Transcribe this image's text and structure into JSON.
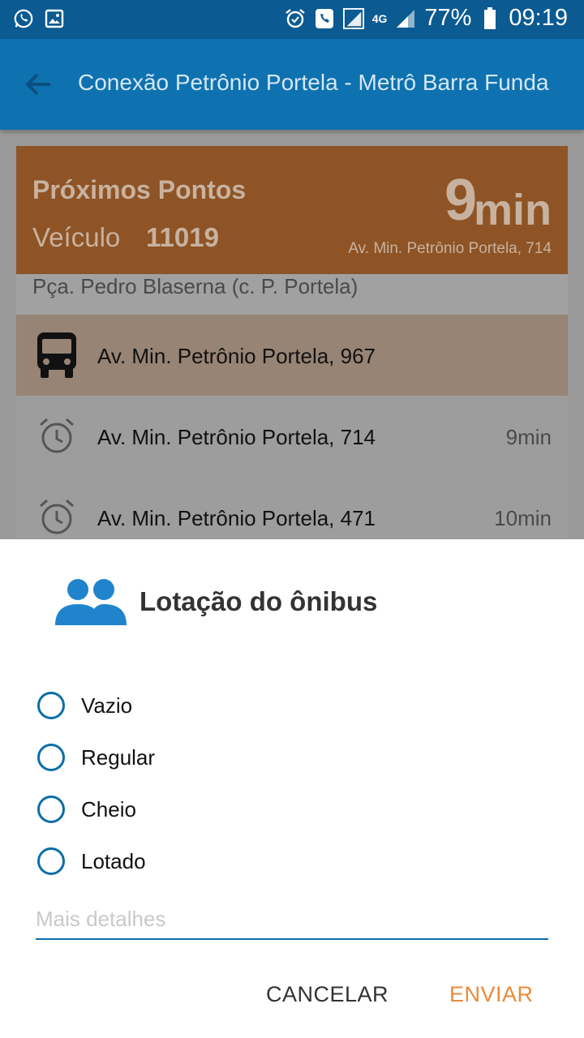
{
  "status_bar": {
    "battery_percent": "77%",
    "time": "09:19",
    "network_label": "4G",
    "icons": [
      "whatsapp-icon",
      "gallery-icon",
      "alarm-icon",
      "phone-icon",
      "signal-icon",
      "battery-icon"
    ]
  },
  "app_bar": {
    "title": "Conexão Petrônio Portela - Metrô Barra Funda",
    "back_icon": "arrow-left-icon",
    "color": "#0e72b0"
  },
  "card_header": {
    "title": "Próximos Pontos",
    "vehicle_label": "Veículo",
    "vehicle_number": "11019",
    "eta_value": "9",
    "eta_unit": "min",
    "eta_address": "Av. Min. Petrônio Portela, 714",
    "color": "#e07520"
  },
  "stops": {
    "previous": "Pça. Pedro Blaserna (c. P. Portela)",
    "items": [
      {
        "label": "Av. Min. Petrônio Portela, 967",
        "time": "",
        "icon": "bus-icon"
      },
      {
        "label": "Av. Min. Petrônio Portela, 714",
        "time": "9min",
        "icon": "alarm-clock-icon"
      },
      {
        "label": "Av. Min. Petrônio Portela, 471",
        "time": "10min",
        "icon": "alarm-clock-icon"
      }
    ]
  },
  "dialog": {
    "title": "Lotação do ônibus",
    "icon": "people-icon",
    "options": [
      "Vazio",
      "Regular",
      "Cheio",
      "Lotado"
    ],
    "details_placeholder": "Mais detalhes",
    "details_value": "",
    "cancel_label": "CANCELAR",
    "send_label": "ENVIAR",
    "accent_color": "#0b6ea8",
    "send_color": "#e88b3a"
  }
}
